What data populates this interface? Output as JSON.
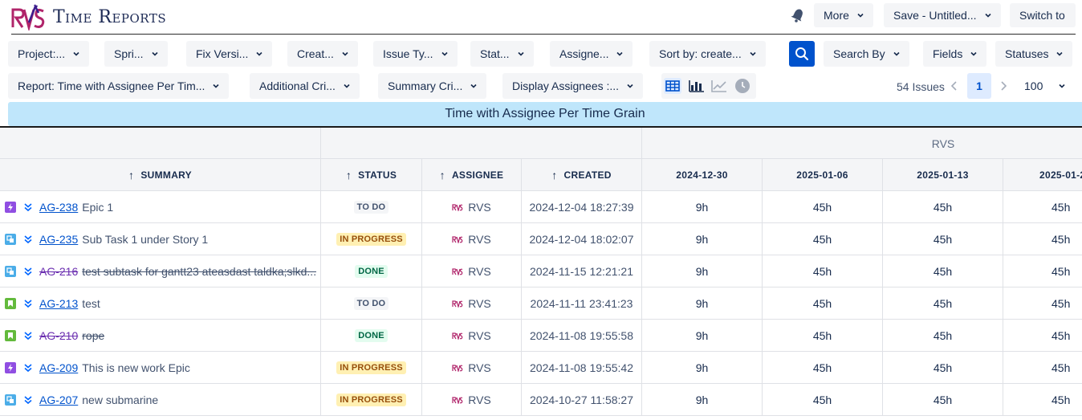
{
  "app": {
    "title": "Time Reports",
    "header_buttons": [
      {
        "label": "More"
      },
      {
        "label": "Save - Untitled..."
      },
      {
        "label": "Switch to"
      }
    ]
  },
  "filters": {
    "row1": [
      {
        "label": "Project:..."
      },
      {
        "label": "Spri..."
      },
      {
        "label": "Fix Versi..."
      },
      {
        "label": "Creat..."
      },
      {
        "label": "Issue Ty..."
      },
      {
        "label": "Stat..."
      },
      {
        "label": "Assigne..."
      },
      {
        "label": "Sort by: create..."
      },
      {
        "label": "Search By"
      },
      {
        "label": "Fields"
      },
      {
        "label": "Statuses"
      }
    ],
    "row2": [
      {
        "label": "Report: Time with Assignee Per Tim..."
      },
      {
        "label": "Additional Cri..."
      },
      {
        "label": "Summary Cri..."
      },
      {
        "label": "Display Assignees :..."
      }
    ]
  },
  "pagination": {
    "issues_label": "54 Issues",
    "current_page": "1",
    "page_size": "100"
  },
  "report": {
    "title": "Time with Assignee Per Time Grain",
    "group_label": "RVS",
    "columns": [
      "SUMMARY",
      "STATUS",
      "ASSIGNEE",
      "CREATED"
    ],
    "weeks": [
      "2024-12-30",
      "2025-01-06",
      "2025-01-13",
      "2025-01-2"
    ]
  },
  "colors": {
    "epic": "#904ee2",
    "subtask": "#4bade8",
    "story": "#63ba3c",
    "accent": "#0052cc",
    "banner": "#bfe6fb"
  },
  "rows": [
    {
      "type": "epic",
      "key": "AG-238",
      "summary": "Epic 1",
      "done": false,
      "status": "TO DO",
      "status_kind": "todo",
      "assignee": "RVS",
      "created": "2024-12-04 18:27:39",
      "w": [
        "9h",
        "45h",
        "45h",
        "45h"
      ]
    },
    {
      "type": "subtask",
      "key": "AG-235",
      "summary": "Sub Task 1 under Story 1",
      "done": false,
      "status": "IN PROGRESS",
      "status_kind": "prog",
      "assignee": "RVS",
      "created": "2024-12-04 18:02:07",
      "w": [
        "9h",
        "45h",
        "45h",
        "45h"
      ]
    },
    {
      "type": "subtask",
      "key": "AG-216",
      "summary": "test subtask for gantt23 ateasdast taldka;slkd...",
      "done": true,
      "status": "DONE",
      "status_kind": "done",
      "assignee": "RVS",
      "created": "2024-11-15 12:21:21",
      "w": [
        "9h",
        "45h",
        "45h",
        "45h"
      ]
    },
    {
      "type": "story",
      "key": "AG-213",
      "summary": "test",
      "done": false,
      "status": "TO DO",
      "status_kind": "todo",
      "assignee": "RVS",
      "created": "2024-11-11 23:41:23",
      "w": [
        "9h",
        "45h",
        "45h",
        "45h"
      ]
    },
    {
      "type": "story",
      "key": "AG-210",
      "summary": "rope",
      "done": true,
      "status": "DONE",
      "status_kind": "done",
      "assignee": "RVS",
      "created": "2024-11-08 19:55:58",
      "w": [
        "9h",
        "45h",
        "45h",
        "45h"
      ]
    },
    {
      "type": "epic",
      "key": "AG-209",
      "summary": "This is new work Epic",
      "done": false,
      "status": "IN PROGRESS",
      "status_kind": "prog",
      "assignee": "RVS",
      "created": "2024-11-08 19:55:42",
      "w": [
        "9h",
        "45h",
        "45h",
        "45h"
      ]
    },
    {
      "type": "subtask",
      "key": "AG-207",
      "summary": "new submarine",
      "done": false,
      "status": "IN PROGRESS",
      "status_kind": "prog",
      "assignee": "RVS",
      "created": "2024-10-27 11:58:27",
      "w": [
        "9h",
        "45h",
        "45h",
        "45h"
      ]
    }
  ]
}
